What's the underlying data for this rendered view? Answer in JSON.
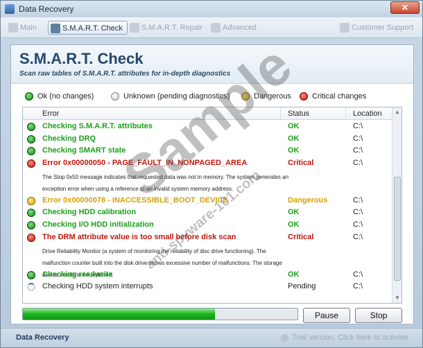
{
  "window": {
    "title": "Data Recovery",
    "close_glyph": "✕"
  },
  "toolbar": {
    "items": [
      {
        "label": "Main",
        "icon": "main-icon",
        "active": false
      },
      {
        "label": "S.M.A.R.T. Check",
        "icon": "check-icon",
        "active": true
      },
      {
        "label": "S.M.A.R.T. Repair",
        "icon": "repair-icon",
        "active": false
      },
      {
        "label": "Advanced",
        "icon": "advanced-icon",
        "active": false
      },
      {
        "label": "Customer Support",
        "icon": "support-icon",
        "active": false
      }
    ]
  },
  "header": {
    "title": "S.M.A.R.T. Check",
    "subtitle": "Scan raw tables of S.M.A.R.T. attributes for in-depth diagnostics"
  },
  "legend": {
    "ok": "Ok (no changes)",
    "unknown": "Unknown (pending diagnostics)",
    "dangerous": "Dangerous",
    "critical": "Critical changes"
  },
  "table": {
    "columns": [
      "Error",
      "Status",
      "Location"
    ],
    "rows": [
      {
        "type": "ok",
        "error": "Checking S.M.A.R.T. attributes",
        "status": "OK",
        "location": "C:\\"
      },
      {
        "type": "ok",
        "error": "Checking DRQ",
        "status": "OK",
        "location": "C:\\"
      },
      {
        "type": "ok",
        "error": "Checking SMART state",
        "status": "OK",
        "location": "C:\\"
      },
      {
        "type": "critical",
        "error": "Error 0x00000050 - PAGE_FAULT_IN_NONPAGED_AREA",
        "status": "Critical",
        "location": "C:\\",
        "description": "The Stop 0x50 message indicates that requested data was not in memory. The system generates an exception error when using a reference to an invalid system memory address."
      },
      {
        "type": "danger",
        "error": "Error 0x00000078 - INACCESSIBLE_BOOT_DEVICE",
        "status": "Dangerous",
        "location": "C:\\"
      },
      {
        "type": "ok",
        "error": "Checking HDD calibration",
        "status": "OK",
        "location": "C:\\"
      },
      {
        "type": "ok",
        "error": "Checking I/O HDD initialization",
        "status": "OK",
        "location": "C:\\"
      },
      {
        "type": "critical",
        "error": "The DRM attribute value is too small before disk scan",
        "status": "Critical",
        "location": "C:\\",
        "description": "Drive Reliability Monitor (a system of monitoring the reliability of disc drive functioning). The malfunction counter built into the disk drive shows excessive number of malfunctions. The storage device needs to be replaced."
      },
      {
        "type": "ok",
        "error": "Checking readwrite",
        "status": "OK",
        "location": "C:\\"
      },
      {
        "type": "pending",
        "error": "Checking HDD system interrupts",
        "status": "Pending",
        "location": "C:\\"
      }
    ]
  },
  "progress": {
    "fraction": 0.7
  },
  "buttons": {
    "pause": "Pause",
    "stop": "Stop"
  },
  "statusbar": {
    "left": "Data Recovery",
    "right": "Trial version. Click here to activate"
  },
  "watermark": {
    "main": "Sample",
    "sub": "anti-spyware-101.com"
  },
  "colors": {
    "ok": "#1aa01a",
    "critical": "#c4150a",
    "dangerous": "#d8a000"
  }
}
